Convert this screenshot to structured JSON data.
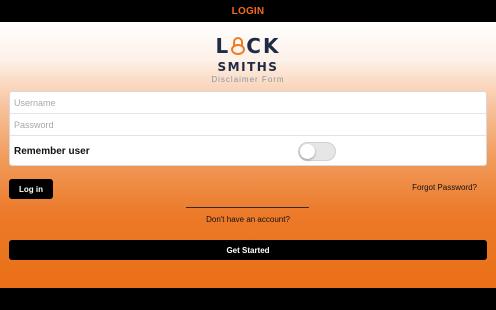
{
  "header": {
    "title": "LOGIN"
  },
  "logo": {
    "brand_left": "L",
    "brand_right": "CK",
    "brand_line2": "SMITHS",
    "subtitle": "Disclaimer Form"
  },
  "form": {
    "username": {
      "placeholder": "Username",
      "value": ""
    },
    "password": {
      "placeholder": "Password",
      "value": ""
    },
    "remember_label": "Remember user",
    "remember_on": false
  },
  "actions": {
    "login_label": "Log in",
    "forgot_label": "Forgot Password?",
    "no_account_label": "Don't have an account?",
    "get_started_label": "Get Started"
  },
  "colors": {
    "accent": "#f26a1b",
    "brand_navy": "#1f2a44",
    "bar": "#000000"
  },
  "icons": [
    "padlock-icon"
  ]
}
